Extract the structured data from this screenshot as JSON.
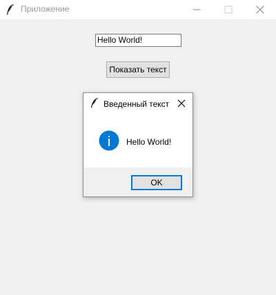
{
  "window": {
    "title": "Приложение"
  },
  "main": {
    "entry_value": "Hello World!",
    "show_button_label": "Показать текст"
  },
  "dialog": {
    "title": "Введенный текст",
    "message": "Hello World!",
    "ok_label": "OK",
    "icon": "info-icon"
  },
  "colors": {
    "window_bg": "#f0f0f0",
    "titlebar_bg": "#ffffff",
    "title_text": "#999999",
    "info_icon": "#0078d7",
    "ok_border": "#0078d7"
  }
}
